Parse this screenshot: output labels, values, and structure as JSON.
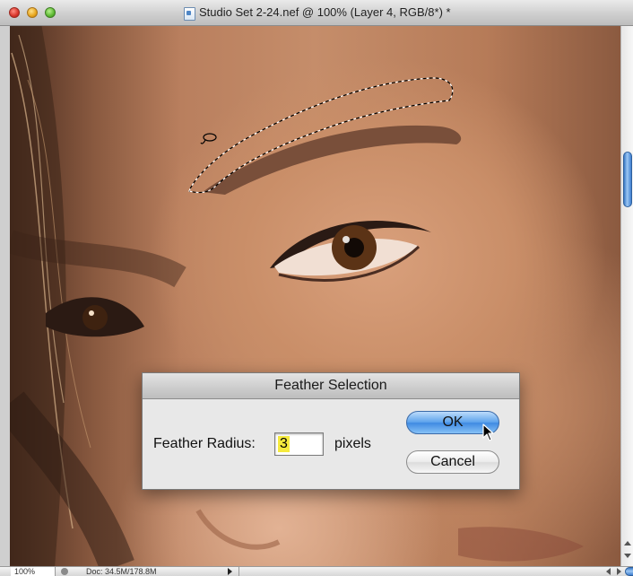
{
  "window": {
    "title": "Studio Set 2-24.nef @ 100% (Layer 4, RGB/8*) *"
  },
  "statusbar": {
    "zoom": "100%",
    "doc_size": "Doc: 34.5M/178.8M"
  },
  "dialog": {
    "title": "Feather Selection",
    "radius_label": "Feather Radius:",
    "radius_value": "3",
    "units": "pixels",
    "ok_label": "OK",
    "cancel_label": "Cancel"
  },
  "colors": {
    "accent": "#4a8fe4",
    "highlight": "#f5ea3d"
  },
  "icons": {
    "close": "close-icon",
    "minimize": "minimize-icon",
    "zoom": "zoom-icon",
    "document": "document-icon",
    "cursor": "pointer-cursor-icon"
  }
}
